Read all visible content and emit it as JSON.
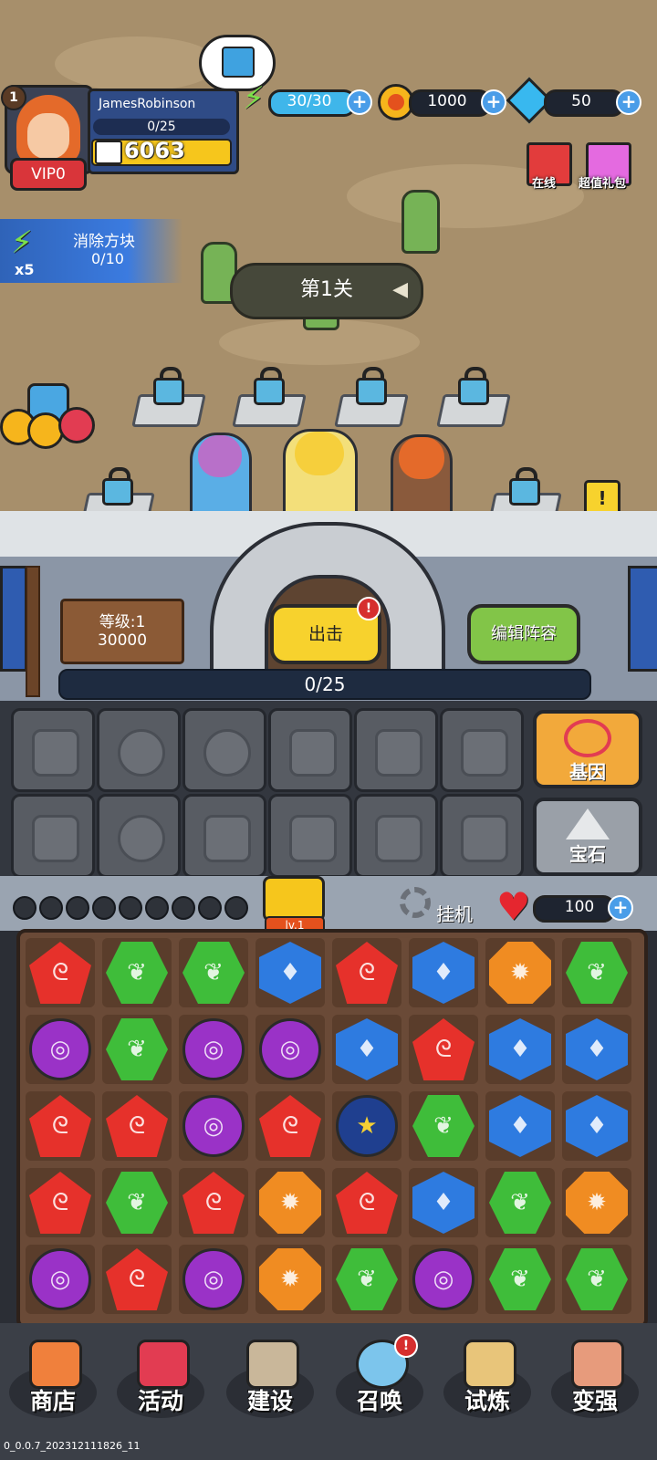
{
  "player": {
    "level": "1",
    "name": "JamesRobinson",
    "xp": "0/25",
    "power": "6063",
    "vip": "VIP0"
  },
  "resources": {
    "energy": "30/30",
    "gold": "1000",
    "diamond": "50"
  },
  "gifts": {
    "online": "在线",
    "value_pack": "超值礼包"
  },
  "quest": {
    "title": "消除方块",
    "progress": "0/10",
    "multiplier": "x5"
  },
  "stage": {
    "label": "第1关"
  },
  "castle": {
    "level_label": "等级:1",
    "level_value": "30000",
    "attack_button": "出击",
    "edit_team_button": "编辑阵容",
    "progress": "0/25"
  },
  "side_buttons": {
    "gene": "基因",
    "gem": "宝石"
  },
  "board_header": {
    "chest_level": "lv.1",
    "idle_label": "挂机",
    "hp": "100"
  },
  "board": {
    "rows": [
      [
        "red",
        "green",
        "green",
        "blue",
        "red",
        "blue",
        "orange",
        "green"
      ],
      [
        "purple",
        "green",
        "purple",
        "purple",
        "blue",
        "red",
        "blue",
        "blue"
      ],
      [
        "red",
        "red",
        "purple",
        "red",
        "bomb",
        "green",
        "blue",
        "blue"
      ],
      [
        "red",
        "green",
        "red",
        "orange",
        "red",
        "blue",
        "green",
        "orange"
      ],
      [
        "purple",
        "red",
        "purple",
        "orange",
        "green",
        "purple",
        "green",
        "green"
      ]
    ]
  },
  "nav": {
    "items": [
      {
        "label": "商店",
        "icon": "shop-icon",
        "color": "#f0803c"
      },
      {
        "label": "活动",
        "icon": "event-gift-icon",
        "color": "#e23c52"
      },
      {
        "label": "建设",
        "icon": "castle-icon",
        "color": "#c9b79a"
      },
      {
        "label": "召唤",
        "icon": "summon-orb-icon",
        "color": "#7cc5ec"
      },
      {
        "label": "试炼",
        "icon": "crossed-swords-icon",
        "color": "#e8c57a"
      },
      {
        "label": "变强",
        "icon": "fist-icon",
        "color": "#e79b7c"
      }
    ]
  },
  "version": "0_0.0.7_202312111826_11",
  "colors": {
    "gem_red": "#e6312b",
    "gem_green": "#3fbd3a",
    "gem_blue": "#2e7be0",
    "gem_purple": "#9a32c7",
    "gem_orange": "#f08c22",
    "attack_yellow": "#f7d22d",
    "edit_green": "#82c548"
  }
}
